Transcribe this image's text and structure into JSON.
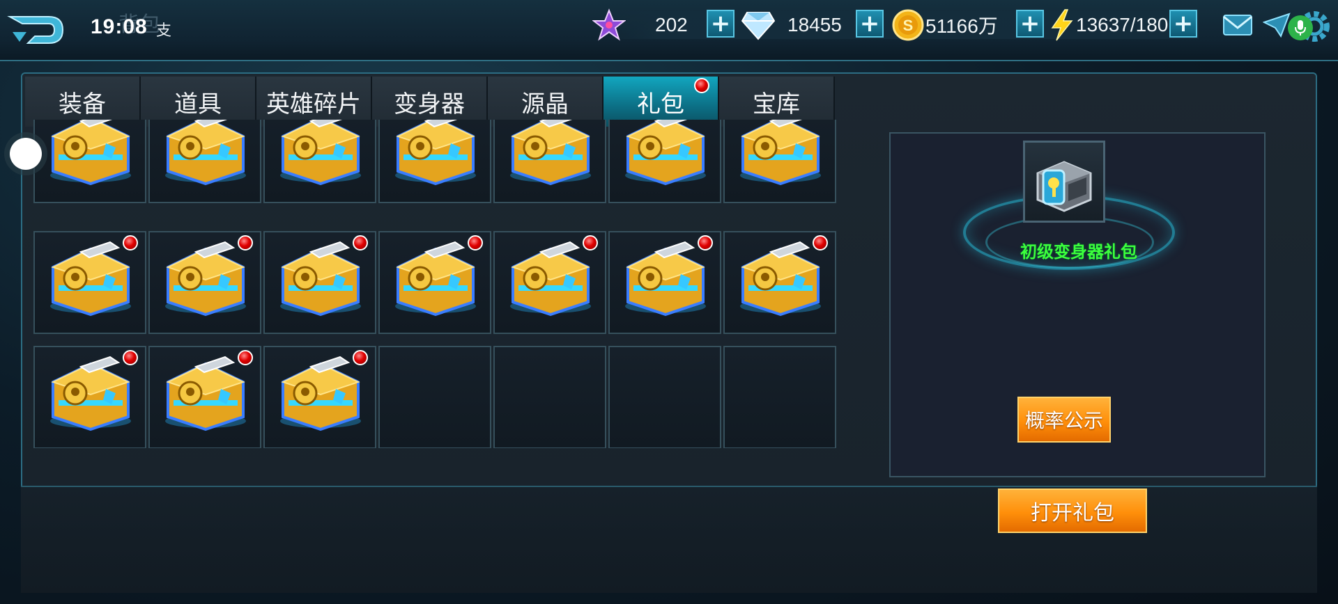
{
  "header": {
    "clock": "19:08",
    "title_ghost": "背包",
    "title_glyph": "支",
    "back_icon": "back-arrow-icon"
  },
  "resources": [
    {
      "icon": "star-icon",
      "value": "202"
    },
    {
      "icon": "diamond-icon",
      "value": "18455"
    },
    {
      "icon": "gold-coin-icon",
      "value": "51166万"
    },
    {
      "icon": "lightning-icon",
      "value": "13637/180"
    }
  ],
  "tabs": [
    {
      "label": "装备",
      "active": false,
      "badge": false
    },
    {
      "label": "道具",
      "active": false,
      "badge": false
    },
    {
      "label": "英雄碎片",
      "active": false,
      "badge": false
    },
    {
      "label": "变身器",
      "active": false,
      "badge": false
    },
    {
      "label": "源晶",
      "active": false,
      "badge": false
    },
    {
      "label": "礼包",
      "active": true,
      "badge": true
    },
    {
      "label": "宝库",
      "active": false,
      "badge": false
    }
  ],
  "inventory": {
    "columns": 7,
    "filled_slots": 17,
    "total_slots": 21,
    "item_icon": "golden-chest-icon"
  },
  "detail": {
    "item_name": "初级变身器礼包",
    "item_icon": "morpher-gift-chest-icon",
    "probability_button": "概率公示",
    "open_button": "打开礼包"
  },
  "colors": {
    "accent": "#12a6bf",
    "item_name": "#3cff3c",
    "button": "#ff8f0a",
    "badge": "#e10000"
  }
}
